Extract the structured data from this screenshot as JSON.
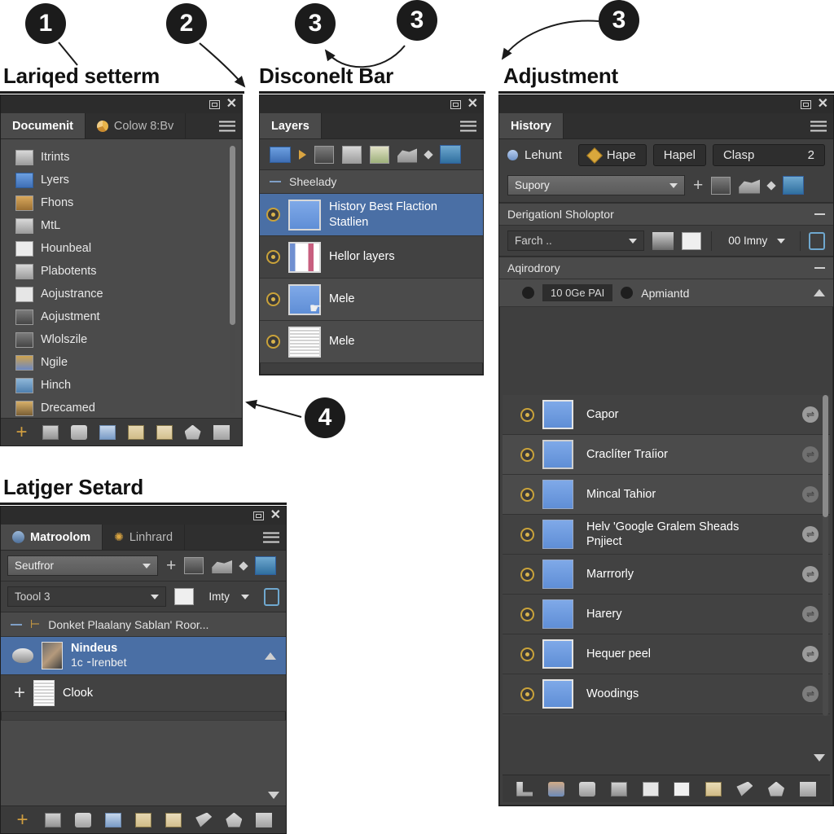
{
  "annotations": {
    "markers": [
      {
        "number": "1"
      },
      {
        "number": "2"
      },
      {
        "number": "3"
      },
      {
        "number": "3"
      },
      {
        "number": "3"
      },
      {
        "number": "4"
      }
    ],
    "labels": [
      {
        "text": "Lariqed setterm"
      },
      {
        "text": "Disconelt  Bar"
      },
      {
        "text": "Adjustment"
      },
      {
        "text": "Latjger Setard"
      }
    ]
  },
  "documents_panel": {
    "tabs": [
      {
        "label": "Documenit",
        "icon": "document-icon",
        "active": true
      },
      {
        "label": "Colow 8:Bv",
        "icon": "color-wheel-icon",
        "active": false
      }
    ],
    "items": [
      {
        "label": "Itrints",
        "icon": "file-page-icon"
      },
      {
        "label": "Lyers",
        "icon": "layers-icon"
      },
      {
        "label": "Fhons",
        "icon": "photo-icon"
      },
      {
        "label": "MtL",
        "icon": "file-page-icon"
      },
      {
        "label": "Hounbeal",
        "icon": "blank-page-icon"
      },
      {
        "label": "Plabotents",
        "icon": "file-page-icon"
      },
      {
        "label": "Aojustrance",
        "icon": "blank-page-icon"
      },
      {
        "label": "Aojustment",
        "icon": "image-page-icon"
      },
      {
        "label": "Wlolszile",
        "icon": "image-page-icon"
      },
      {
        "label": "Ngile",
        "icon": "photo-icon"
      },
      {
        "label": "Hinch",
        "icon": "globe-page-icon"
      },
      {
        "label": "Drecamed",
        "icon": "image-page-icon"
      }
    ],
    "footer_icons": [
      "add-icon",
      "new-adjustment-icon",
      "stamp-icon",
      "list-icon",
      "crown-icon",
      "crown-alt-icon",
      "home-edit-icon",
      "delete-icon"
    ]
  },
  "layers_panel": {
    "tabs": [
      {
        "label": "Layers",
        "active": true
      }
    ],
    "toolbar_icons": [
      "blue-folder-icon",
      "play-arrow-icon",
      "mask-image-icon",
      "image-card-icon",
      "export-arrow-icon",
      "cloud-brush-icon",
      "diamond-icon",
      "image-preview-icon"
    ],
    "group_label": "Sheelady",
    "rows": [
      {
        "name": "History Best Flaction Statlien",
        "thumb": "blue-thumb",
        "selected": true,
        "visible": true
      },
      {
        "name": "Hellor layers",
        "thumb": "mixed-thumb",
        "selected": false,
        "visible": true
      },
      {
        "name": "Mele",
        "thumb": "blue-thumb",
        "selected": false,
        "visible": true,
        "cursor": true
      },
      {
        "name": "Mele",
        "thumb": "lined-thumb",
        "selected": false,
        "visible": true
      }
    ]
  },
  "history_panel": {
    "tabs": [
      {
        "label": "History",
        "active": true
      }
    ],
    "toolbar_buttons": [
      {
        "label": "Lehunt",
        "icon": "blue-dot-icon"
      },
      {
        "label": "Hape",
        "icon": "gold-diamond-icon"
      },
      {
        "label": "Hapel",
        "icon": ""
      },
      {
        "label": "Clasp",
        "icon": "",
        "value": "2"
      }
    ],
    "preset_dropdown": {
      "value": "Supory"
    },
    "preset_icons": [
      "add-icon",
      "mask-image-icon",
      "cloud-brush-icon",
      "diamond-icon",
      "image-preview-icon"
    ],
    "section_one": {
      "title": "Derigationl Sholoptor"
    },
    "search_field": {
      "value": "Farch .."
    },
    "tool_icons": [
      "stamp-icon",
      "histogram-icon"
    ],
    "opacity_dropdown": {
      "value": "00 Imny"
    },
    "lock_icon": "lock-icon",
    "section_two": {
      "title": "Aqirodrory"
    },
    "column_header": {
      "left_value": "10 0Ge PAI",
      "right_value": "Apmiantd"
    },
    "rows": [
      {
        "name": "Capor",
        "selected_outline": true
      },
      {
        "name": "Craclíter Traíior",
        "selected_outline": true
      },
      {
        "name": "Mincal Tahior",
        "selected_outline": false
      },
      {
        "name": "Helv 'Google Gralem Sheads Pnjiect",
        "selected_outline": false
      },
      {
        "name": "Marrrorly",
        "selected_outline": false
      },
      {
        "name": "Harery",
        "selected_outline": false
      },
      {
        "name": "Hequer peel",
        "selected_outline": true
      },
      {
        "name": "Woodings",
        "selected_outline": true
      }
    ],
    "footer_icons": [
      "corner-icon",
      "paint-bucket-icon",
      "stamp-icon",
      "new-adjustment-icon",
      "crown-box-icon",
      "page-tool-icon",
      "crown-icon",
      "scissors-icon",
      "home-icon",
      "delete-icon"
    ]
  },
  "library_panel": {
    "tabs": [
      {
        "label": "Matroolom",
        "icon": "globe-icon",
        "active": true
      },
      {
        "label": "Linhrard",
        "icon": "star-icon",
        "active": false
      }
    ],
    "source_dropdown": {
      "value": "Seutfror"
    },
    "source_icons": [
      "add-icon",
      "mask-image-icon",
      "cloud-brush-icon",
      "diamond-icon",
      "image-preview-icon"
    ],
    "tool_dropdown": {
      "value": "Toool 3"
    },
    "mode_dropdown": {
      "value": "Imty",
      "icon": "frame-icon"
    },
    "lock_icon": "lock-icon",
    "group_label": "Donket Plaalany Sablan' Roor...",
    "rows": [
      {
        "name": "Nindeus",
        "sub": "1c ⁃lrenbet",
        "selected": true,
        "icon": "cloud-thumb",
        "thumb": "photo-thumb"
      },
      {
        "name": "Clook",
        "sub": "",
        "selected": false,
        "icon": "plus-icon",
        "thumb": "lined-thumb"
      }
    ],
    "footer_icons": [
      "add-icon",
      "new-adjustment-icon",
      "stamp-icon",
      "list-icon",
      "crown-icon",
      "crown-alt-icon",
      "scissors-icon",
      "home-icon",
      "delete-icon"
    ]
  },
  "colors": {
    "panel_bg": "#3f3f3f",
    "panel_alt": "#4b4b4b",
    "titlebar": "#2c2c2c",
    "tab_active": "#4a4a4a",
    "selection_blue": "#4a6fa5",
    "accent_gold": "#d9a441",
    "text": "#e8e8e8",
    "page_bg": "#ffffff"
  }
}
